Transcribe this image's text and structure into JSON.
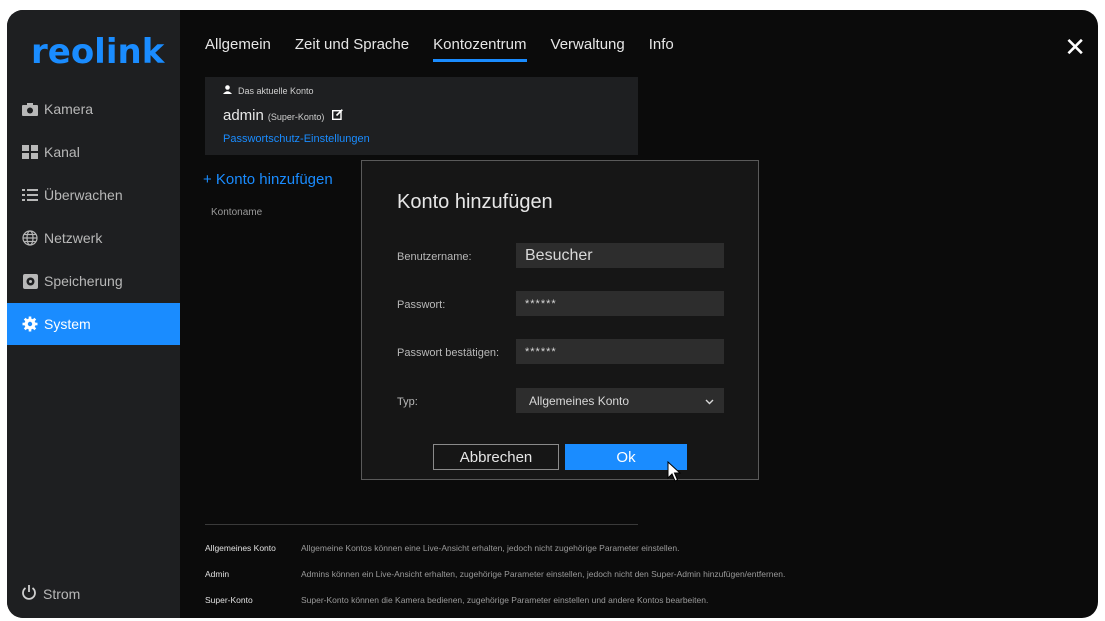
{
  "app": {
    "logo": "reolink"
  },
  "sidebar": {
    "items": [
      {
        "label": "Kamera",
        "icon": "camera-icon"
      },
      {
        "label": "Kanal",
        "icon": "grid-icon"
      },
      {
        "label": "Überwachen",
        "icon": "list-icon"
      },
      {
        "label": "Netzwerk",
        "icon": "globe-icon"
      },
      {
        "label": "Speicherung",
        "icon": "storage-icon"
      },
      {
        "label": "System",
        "icon": "gear-icon",
        "active": true
      }
    ],
    "power_label": "Strom"
  },
  "tabs": [
    {
      "label": "Allgemein"
    },
    {
      "label": "Zeit und Sprache"
    },
    {
      "label": "Kontozentrum",
      "active": true
    },
    {
      "label": "Verwaltung"
    },
    {
      "label": "Info"
    }
  ],
  "account": {
    "current_label": "Das aktuelle Konto",
    "name": "admin",
    "role": "(Super-Konto)",
    "password_link": "Passwortschutz-Einstellungen"
  },
  "list": {
    "add_label": "+ Konto hinzufügen",
    "column_header": "Kontoname"
  },
  "modal": {
    "title": "Konto hinzufügen",
    "username_label": "Benutzername:",
    "username_value": "Besucher",
    "password_label": "Passwort:",
    "password_value": "******",
    "confirm_label": "Passwort bestätigen:",
    "confirm_value": "******",
    "type_label": "Typ:",
    "type_value": "Allgemeines Konto",
    "cancel_label": "Abbrechen",
    "ok_label": "Ok"
  },
  "legend": [
    {
      "key": "Allgemeines Konto",
      "text": "Allgemeine Kontos können eine Live-Ansicht erhalten, jedoch nicht zugehörige Parameter einstellen."
    },
    {
      "key": "Admin",
      "text": "Admins können ein Live-Ansicht erhalten, zugehörige Parameter einstellen, jedoch nicht den Super-Admin hinzufügen/entfernen."
    },
    {
      "key": "Super-Konto",
      "text": "Super-Konto können die Kamera bedienen, zugehörige Parameter einstellen und andere Kontos bearbeiten."
    }
  ],
  "colors": {
    "accent": "#1a8cff",
    "sidebar_bg": "#1e1f21",
    "background": "#0b0b0b"
  }
}
